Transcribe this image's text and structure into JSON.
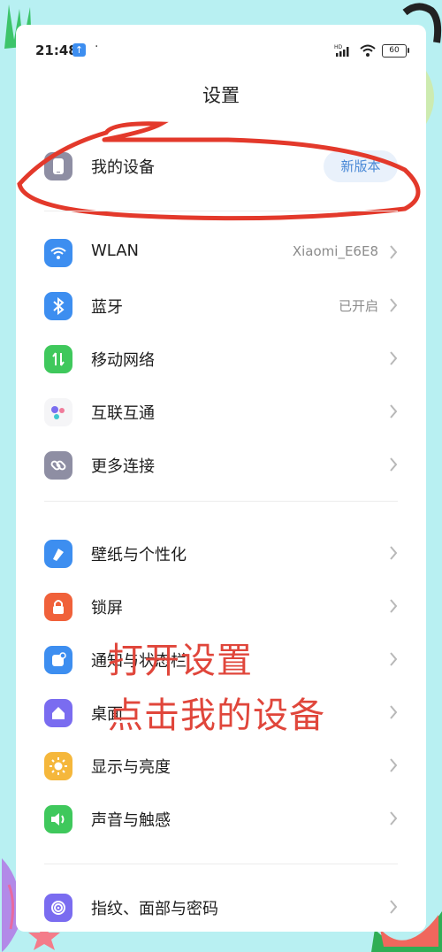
{
  "status_bar": {
    "time": "21:48",
    "upload_icon": "arrow-up-icon",
    "dot": "·",
    "signal_label": "HD",
    "battery": "60"
  },
  "page_title": "设置",
  "my_device": {
    "label": "我的设备",
    "badge": "新版本"
  },
  "items": [
    {
      "label": "WLAN",
      "value": "Xiaomi_E6E8",
      "icon": "wifi-icon",
      "color": "#3d8ef0"
    },
    {
      "label": "蓝牙",
      "value": "已开启",
      "icon": "bluetooth-icon",
      "color": "#3d8ef0"
    },
    {
      "label": "移动网络",
      "value": "",
      "icon": "mobile-data-icon",
      "color": "#3fc85c"
    },
    {
      "label": "互联互通",
      "value": "",
      "icon": "interconnect-icon",
      "color": "#f5f5f7"
    },
    {
      "label": "更多连接",
      "value": "",
      "icon": "link-icon",
      "color": "#8e8ea3"
    },
    {
      "label": "壁纸与个性化",
      "value": "",
      "icon": "brush-icon",
      "color": "#3d8ef0"
    },
    {
      "label": "锁屏",
      "value": "",
      "icon": "lock-icon",
      "color": "#f0613a"
    },
    {
      "label": "通知与状态栏",
      "value": "",
      "icon": "notification-icon",
      "color": "#3d8ef0"
    },
    {
      "label": "桌面",
      "value": "",
      "icon": "home-icon",
      "color": "#7a6cf0"
    },
    {
      "label": "显示与亮度",
      "value": "",
      "icon": "sun-icon",
      "color": "#f5b73b"
    },
    {
      "label": "声音与触感",
      "value": "",
      "icon": "speaker-icon",
      "color": "#3fc85c"
    },
    {
      "label": "指纹、面部与密码",
      "value": "",
      "icon": "fingerprint-icon",
      "color": "#7a6cf0"
    }
  ],
  "overlay": {
    "line1": "打开设置",
    "line2": "点击我的设备",
    "color": "#e0463b"
  }
}
